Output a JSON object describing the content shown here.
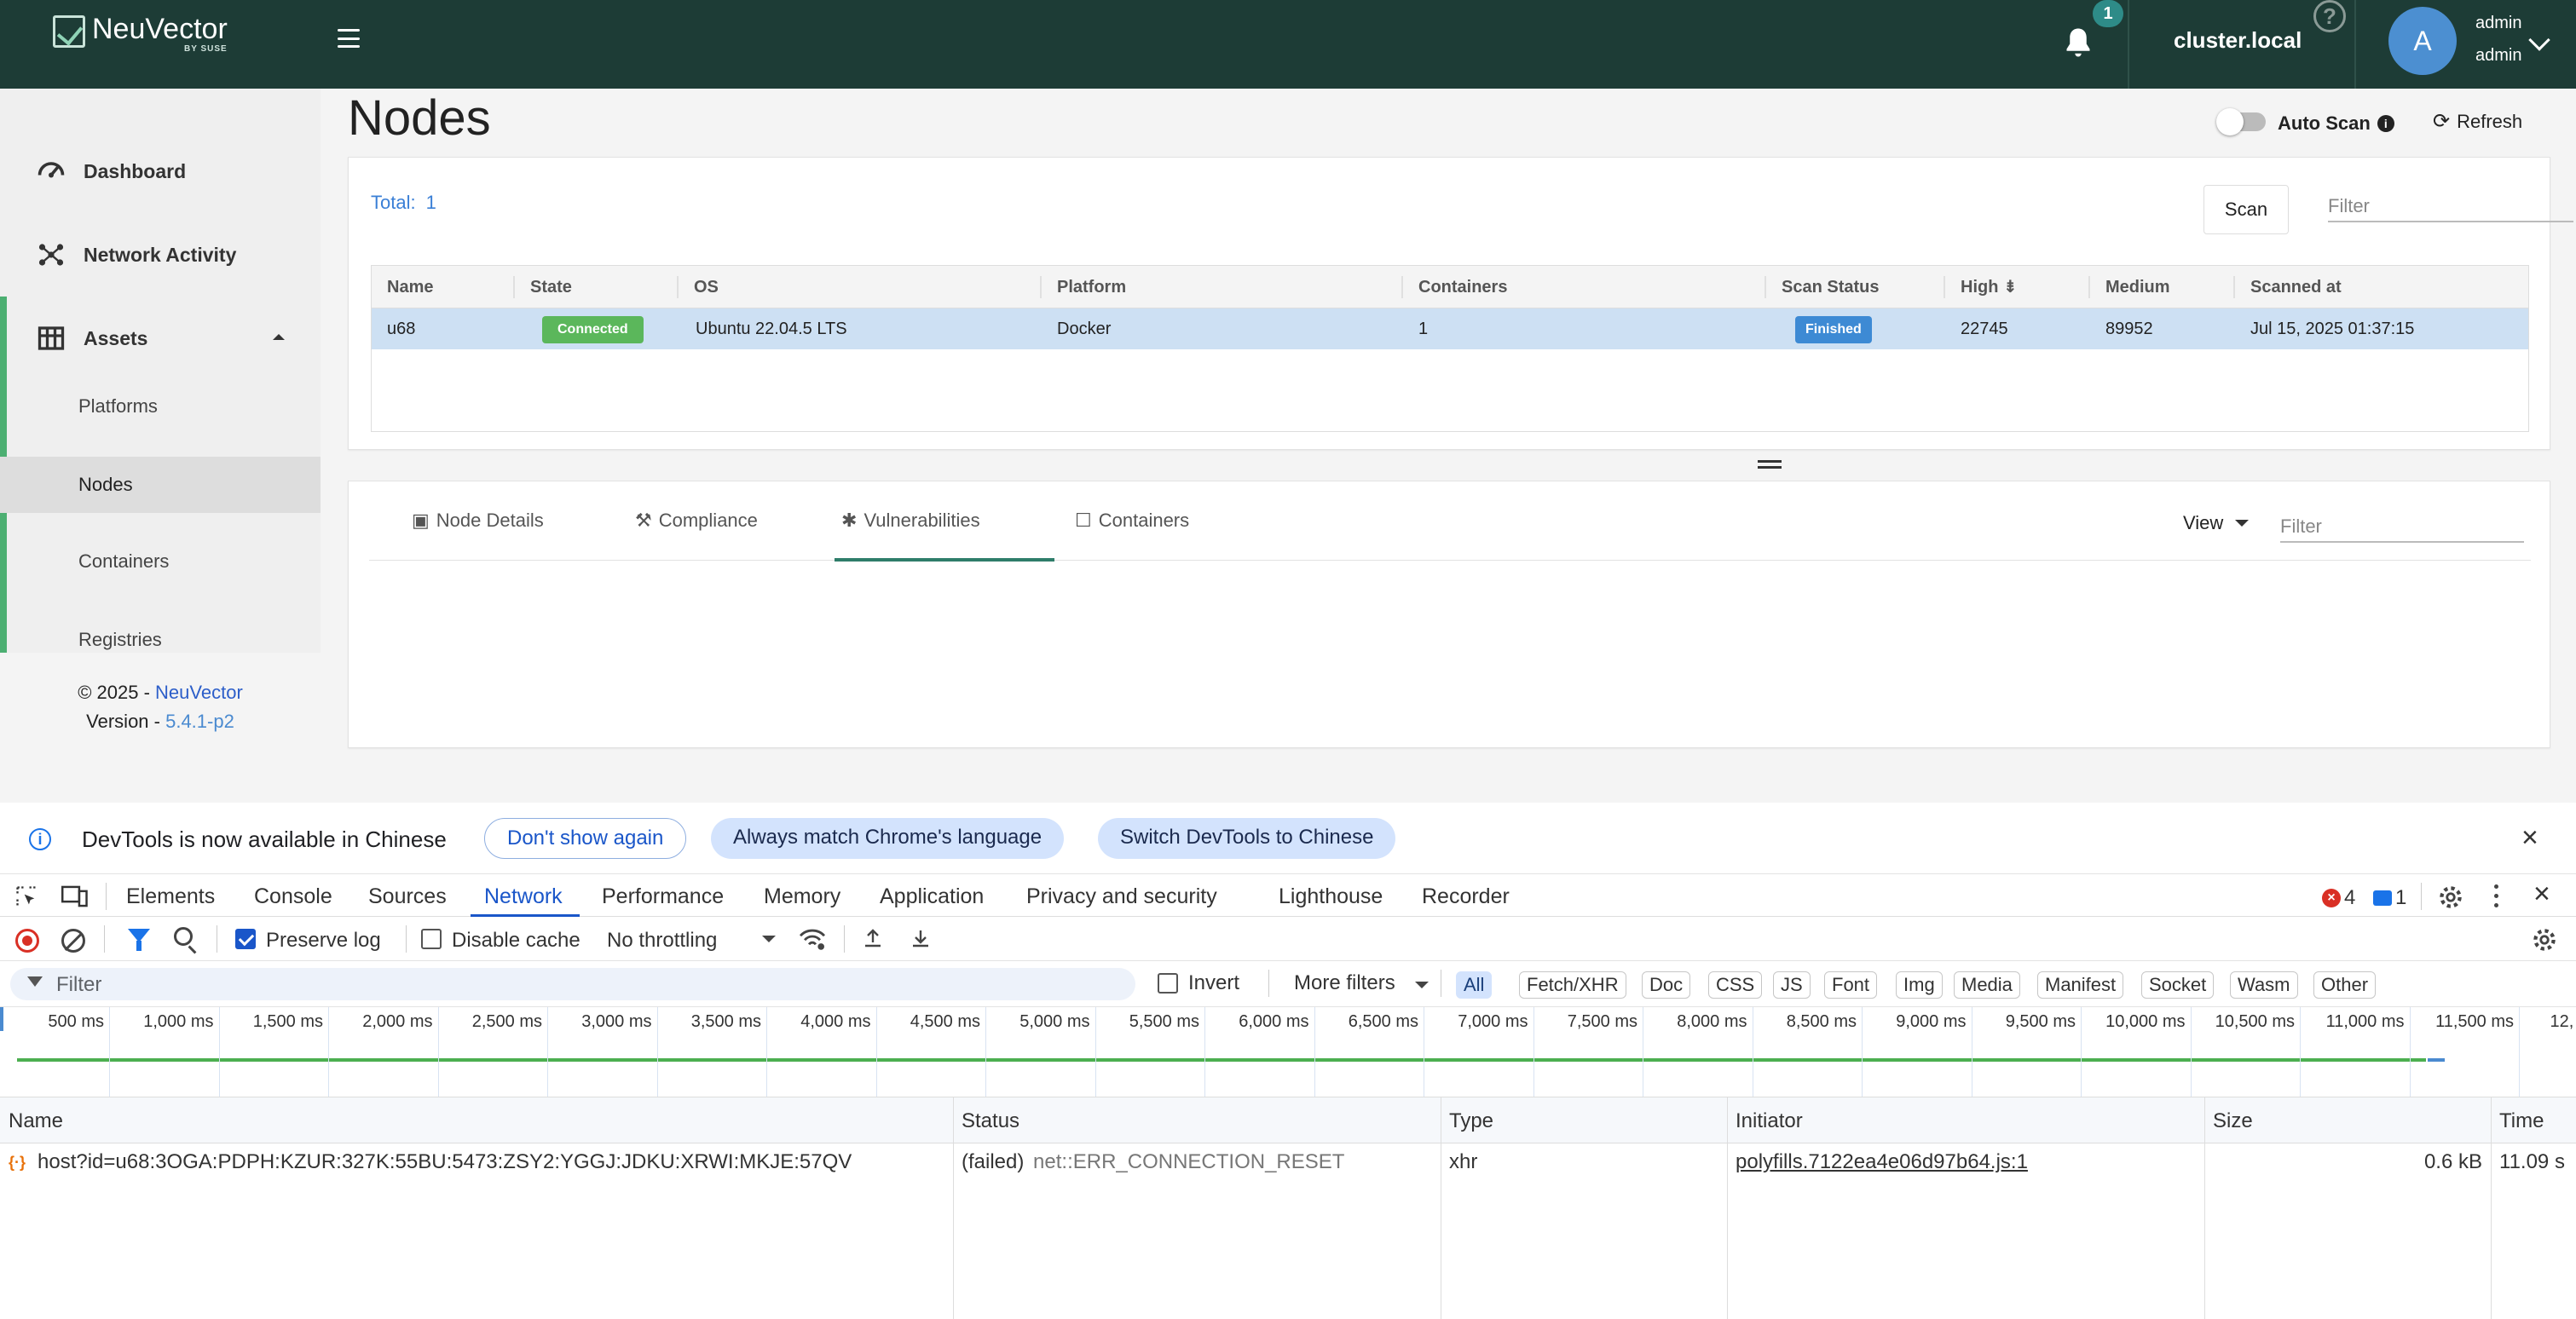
{
  "app": {
    "logo_text": "NeuVector",
    "logo_sub": "BY SUSE",
    "notifications_count": "1",
    "cluster": "cluster.local",
    "help_glyph": "?",
    "avatar_letter": "A",
    "user_name": "admin",
    "user_role": "admin"
  },
  "sidebar": {
    "dashboard": "Dashboard",
    "network_activity": "Network Activity",
    "assets": "Assets",
    "sub": [
      "Platforms",
      "Nodes",
      "Containers",
      "Registries"
    ],
    "copyright_prefix": "© 2025 - ",
    "copyright_link": "NeuVector",
    "version_prefix": "Version - ",
    "version": "5.4.1-p2"
  },
  "page": {
    "title": "Nodes",
    "auto_scan": "Auto Scan",
    "refresh": "Refresh",
    "total_label": "Total:",
    "total_value": "1",
    "scan_button": "Scan",
    "filter_placeholder": "Filter"
  },
  "grid": {
    "columns": [
      "Name",
      "State",
      "OS",
      "Platform",
      "Containers",
      "Scan Status",
      "High",
      "Medium",
      "Scanned at"
    ],
    "rows": [
      {
        "name": "u68",
        "state": "Connected",
        "os": "Ubuntu 22.04.5 LTS",
        "platform": "Docker",
        "containers": "1",
        "scan_status": "Finished",
        "high": "22745",
        "medium": "89952",
        "scanned_at": "Jul 15, 2025 01:37:15"
      }
    ]
  },
  "detail_tabs": {
    "tabs": [
      "Node Details",
      "Compliance",
      "Vulnerabilities",
      "Containers"
    ],
    "active": "Vulnerabilities",
    "view": "View",
    "filter_placeholder": "Filter"
  },
  "devtools": {
    "infobar_message": "DevTools is now available in Chinese",
    "btn_dont_show": "Don't show again",
    "btn_always_match": "Always match Chrome's language",
    "btn_switch": "Switch DevTools to Chinese",
    "tabs": [
      "Elements",
      "Console",
      "Sources",
      "Network",
      "Performance",
      "Memory",
      "Application",
      "Privacy and security",
      "Lighthouse",
      "Recorder"
    ],
    "active_tab": "Network",
    "error_count": "4",
    "message_count": "1",
    "preserve_log": "Preserve log",
    "disable_cache": "Disable cache",
    "throttling": "No throttling",
    "filter_placeholder": "Filter",
    "invert": "Invert",
    "more_filters": "More filters",
    "type_filters": [
      "All",
      "Fetch/XHR",
      "Doc",
      "CSS",
      "JS",
      "Font",
      "Img",
      "Media",
      "Manifest",
      "Socket",
      "Wasm",
      "Other"
    ],
    "timeline_ticks": [
      "500 ms",
      "1,000 ms",
      "1,500 ms",
      "2,000 ms",
      "2,500 ms",
      "3,000 ms",
      "3,500 ms",
      "4,000 ms",
      "4,500 ms",
      "5,000 ms",
      "5,500 ms",
      "6,000 ms",
      "6,500 ms",
      "7,000 ms",
      "7,500 ms",
      "8,000 ms",
      "8,500 ms",
      "9,000 ms",
      "9,500 ms",
      "10,000 ms",
      "10,500 ms",
      "11,000 ms",
      "11,500 ms",
      "12,"
    ],
    "table_columns": [
      "Name",
      "Status",
      "Type",
      "Initiator",
      "Size",
      "Time"
    ],
    "requests": [
      {
        "name": "host?id=u68:3OGA:PDPH:KZUR:327K:55BU:5473:ZSY2:YGGJ:JDKU:XRWI:MKJE:57QV",
        "status": "(failed)",
        "status_detail": "net::ERR_CONNECTION_RESET",
        "type": "xhr",
        "initiator": "polyfills.7122ea4e06d97b64.js:1",
        "size": "0.6 kB",
        "time": "11.09 s"
      }
    ]
  }
}
